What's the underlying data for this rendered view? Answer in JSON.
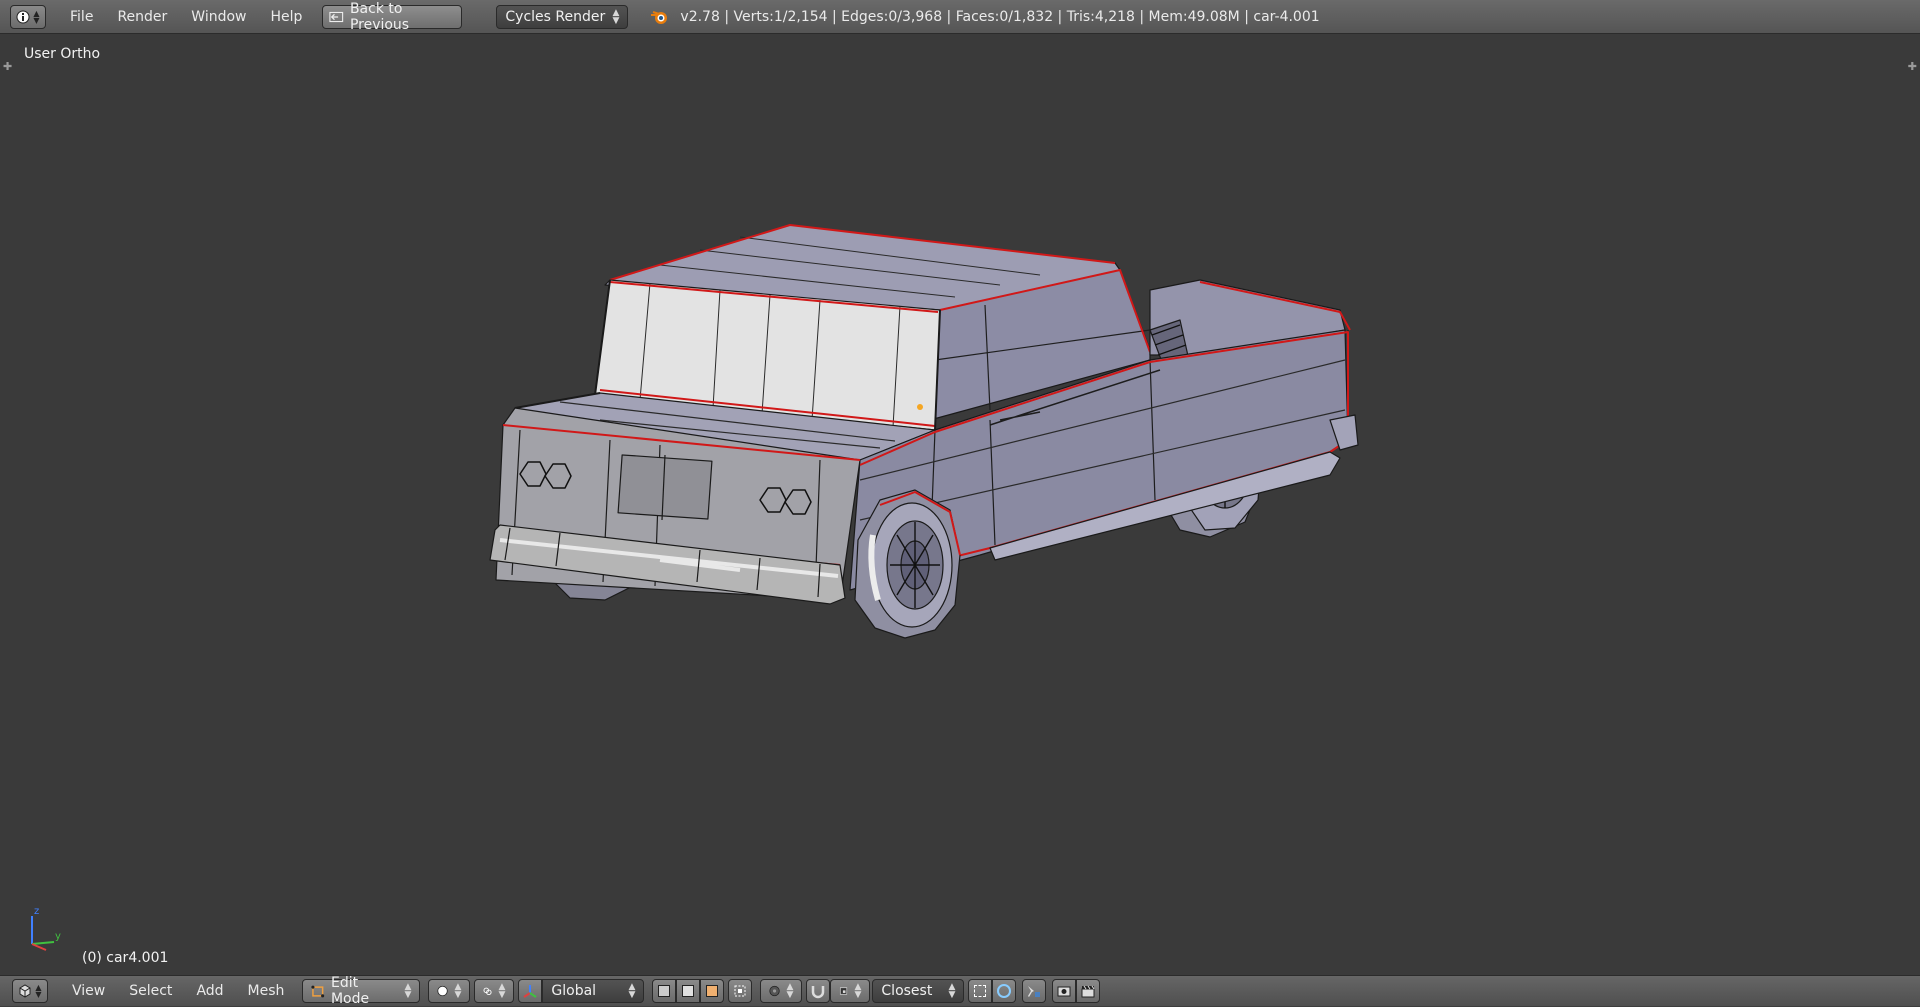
{
  "top": {
    "menu": [
      "File",
      "Render",
      "Window",
      "Help"
    ],
    "back_button": "Back to Previous",
    "engine": "Cycles Render",
    "stats": "v2.78 | Verts:1/2,154 | Edges:0/3,968 | Faces:0/1,832 | Tris:4,218 | Mem:49.08M | car-4.001"
  },
  "viewport": {
    "view_label": "User Ortho",
    "object_label": "(0) car4.001",
    "axis_labels": {
      "z": "z",
      "y": "y"
    }
  },
  "bottom": {
    "menu": [
      "View",
      "Select",
      "Add",
      "Mesh"
    ],
    "mode": "Edit Mode",
    "orientation": "Global",
    "snap_target": "Closest"
  },
  "colors": {
    "header": "#5e5e5e",
    "viewport_bg": "#3a3a3a",
    "mesh_face": "#9b9bb2",
    "selected_edge": "#d11818",
    "window_face": "#e3e3e3"
  }
}
